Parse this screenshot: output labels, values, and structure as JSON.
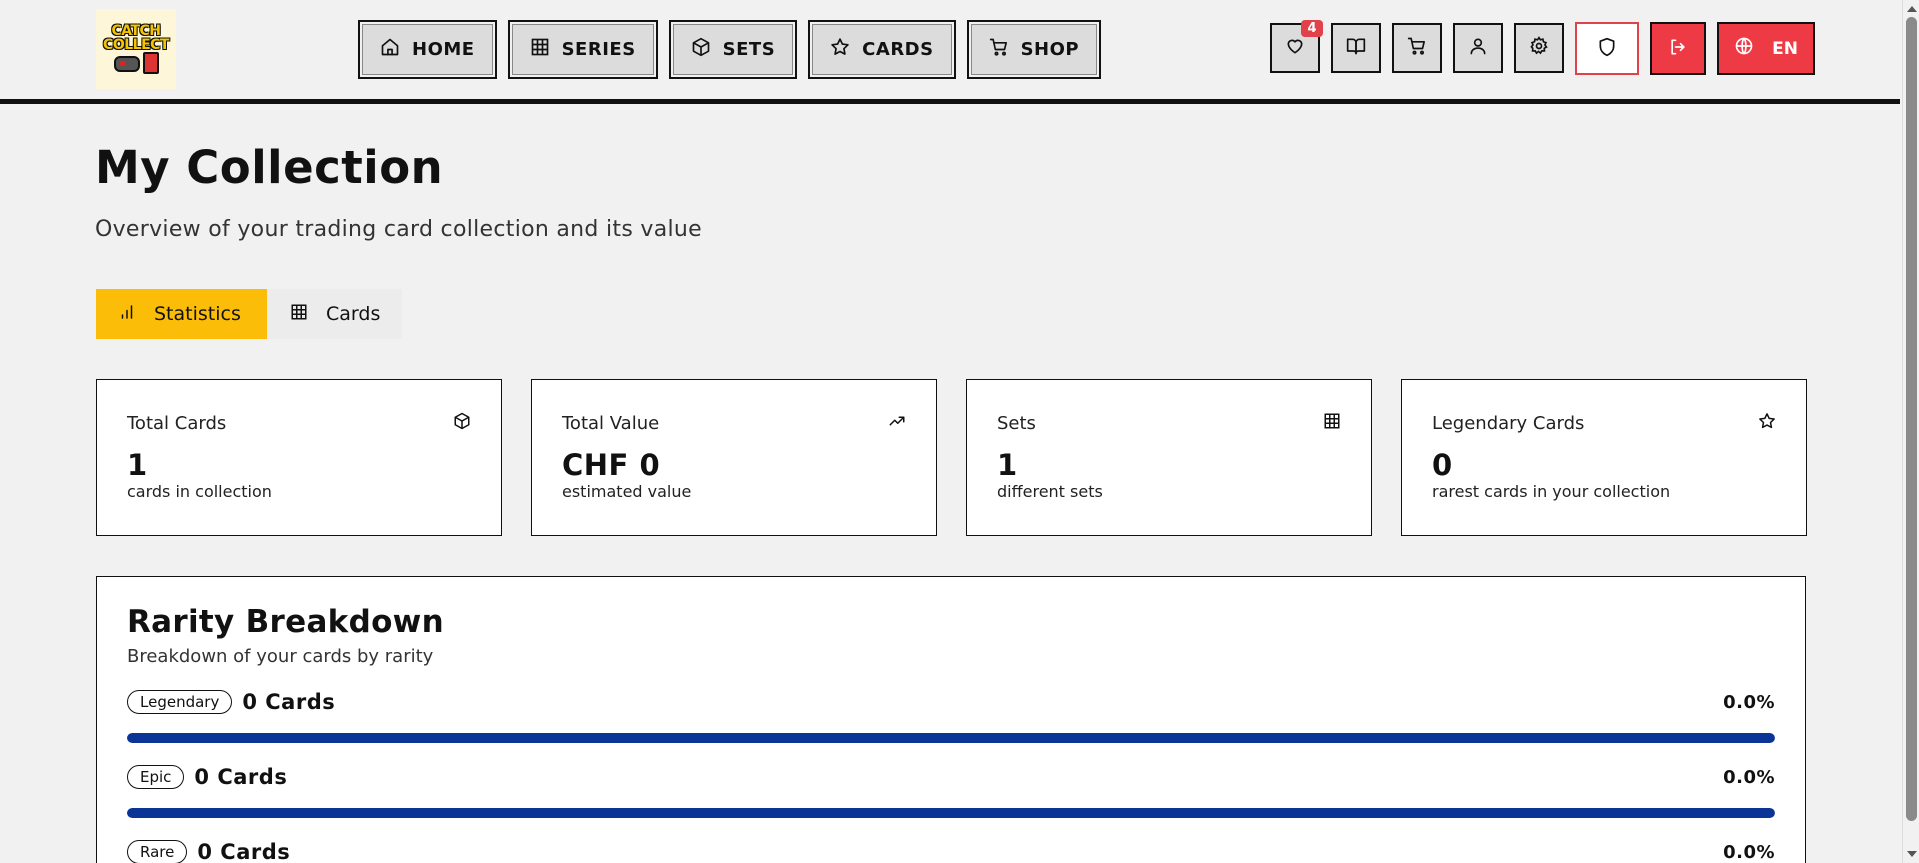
{
  "header": {
    "logo_text": "CATCH COLLECT",
    "nav": [
      {
        "label": "HOME",
        "icon": "home-icon"
      },
      {
        "label": "SERIES",
        "icon": "grid-icon"
      },
      {
        "label": "SETS",
        "icon": "box-icon"
      },
      {
        "label": "CARDS",
        "icon": "star-icon"
      },
      {
        "label": "SHOP",
        "icon": "cart-icon"
      }
    ],
    "tools": {
      "wishlist_badge": "4",
      "language": "EN"
    },
    "colors": {
      "accent": "#ee3a45",
      "primary": "#fbbd08",
      "bar": "#0a3597"
    }
  },
  "page": {
    "title": "My Collection",
    "subtitle": "Overview of your trading card collection and its value"
  },
  "tabs": [
    {
      "label": "Statistics",
      "active": true
    },
    {
      "label": "Cards",
      "active": false
    }
  ],
  "stats": [
    {
      "label": "Total Cards",
      "value": "1",
      "caption": "cards in collection",
      "icon": "box-icon"
    },
    {
      "label": "Total Value",
      "value": "CHF 0",
      "caption": "estimated value",
      "icon": "trending-up-icon"
    },
    {
      "label": "Sets",
      "value": "1",
      "caption": "different sets",
      "icon": "grid-icon"
    },
    {
      "label": "Legendary Cards",
      "value": "0",
      "caption": "rarest cards in your collection",
      "icon": "star-icon"
    }
  ],
  "rarity": {
    "title": "Rarity Breakdown",
    "subtitle": "Breakdown of your cards by rarity",
    "rows": [
      {
        "name": "Legendary",
        "count": "0 Cards",
        "percent": "0.0%",
        "fill": 1.0
      },
      {
        "name": "Epic",
        "count": "0 Cards",
        "percent": "0.0%",
        "fill": 1.0
      },
      {
        "name": "Rare",
        "count": "0 Cards",
        "percent": "0.0%",
        "fill": 1.0
      }
    ]
  }
}
